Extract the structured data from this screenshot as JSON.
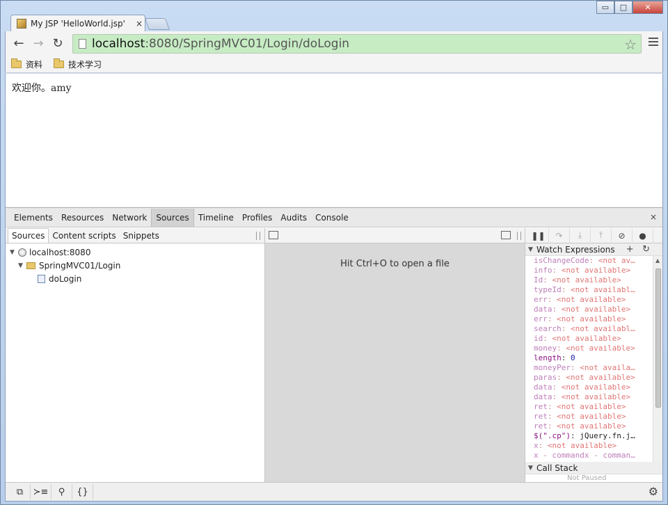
{
  "tab": {
    "title": "My JSP 'HelloWorld.jsp'",
    "close": "×"
  },
  "window_controls": {
    "minimize": "▭",
    "maximize": "□",
    "close": "✕"
  },
  "nav": {
    "back": "←",
    "forward": "→",
    "reload": "↻"
  },
  "address": {
    "host": "localhost",
    "path": ":8080/SpringMVC01/Login/doLogin",
    "star": "☆"
  },
  "bookmarks": [
    {
      "label": "资料"
    },
    {
      "label": "技术学习"
    }
  ],
  "page": {
    "text": "欢迎你。amy"
  },
  "devtools": {
    "tabs": [
      "Elements",
      "Resources",
      "Network",
      "Sources",
      "Timeline",
      "Profiles",
      "Audits",
      "Console"
    ],
    "active_tab": "Sources",
    "close": "×",
    "navigator_tabs": [
      "Sources",
      "Content scripts",
      "Snippets"
    ],
    "tree": {
      "host": "localhost:8080",
      "folder": "SpringMVC01/Login",
      "file": "doLogin"
    },
    "editor_hint": "Hit Ctrl+O to open a file",
    "debug_buttons": [
      "❚❚",
      "↷",
      "⤓",
      "⤒",
      "⊘",
      "●"
    ],
    "watch": {
      "title": "Watch Expressions",
      "add": "+",
      "refresh": "↻",
      "rows": [
        {
          "name": "isChangeCode",
          "value": "<not av…",
          "na": true
        },
        {
          "name": "info",
          "value": "<not available>",
          "na": true
        },
        {
          "name": "Id",
          "value": "<not available>",
          "na": true
        },
        {
          "name": "typeId",
          "value": "<not availabl…",
          "na": true
        },
        {
          "name": "err",
          "value": "<not available>",
          "na": true
        },
        {
          "name": "data",
          "value": "<not available>",
          "na": true
        },
        {
          "name": "err",
          "value": "<not available>",
          "na": true
        },
        {
          "name": "search",
          "value": "<not availabl…",
          "na": true
        },
        {
          "name": "id",
          "value": "<not available>",
          "na": true
        },
        {
          "name": "money",
          "value": "<not available>",
          "na": true
        },
        {
          "name": "length",
          "value": "0",
          "na": false
        },
        {
          "name": "moneyPer",
          "value": "<not availa…",
          "na": true
        },
        {
          "name": "paras",
          "value": "<not available>",
          "na": true
        },
        {
          "name": "data",
          "value": "<not available>",
          "na": true
        },
        {
          "name": "data",
          "value": "<not available>",
          "na": true
        },
        {
          "name": "ret",
          "value": "<not available>",
          "na": true
        },
        {
          "name": "ret",
          "value": "<not available>",
          "na": true
        },
        {
          "name": "ret",
          "value": "<not available>",
          "na": true
        },
        {
          "name": "$(\".cp\")",
          "value": "jQuery.fn.j…",
          "na": false,
          "expandable": true
        },
        {
          "name": "x",
          "value": "<not available>",
          "na": true
        },
        {
          "name": "x - commandx - comman…",
          "value": "",
          "na": true
        }
      ]
    },
    "call_stack": {
      "title": "Call Stack",
      "peek": "Not Paused"
    },
    "footer_buttons": [
      "⧉",
      "≻≡",
      "⚲",
      "{}"
    ],
    "settings": "⚙"
  }
}
